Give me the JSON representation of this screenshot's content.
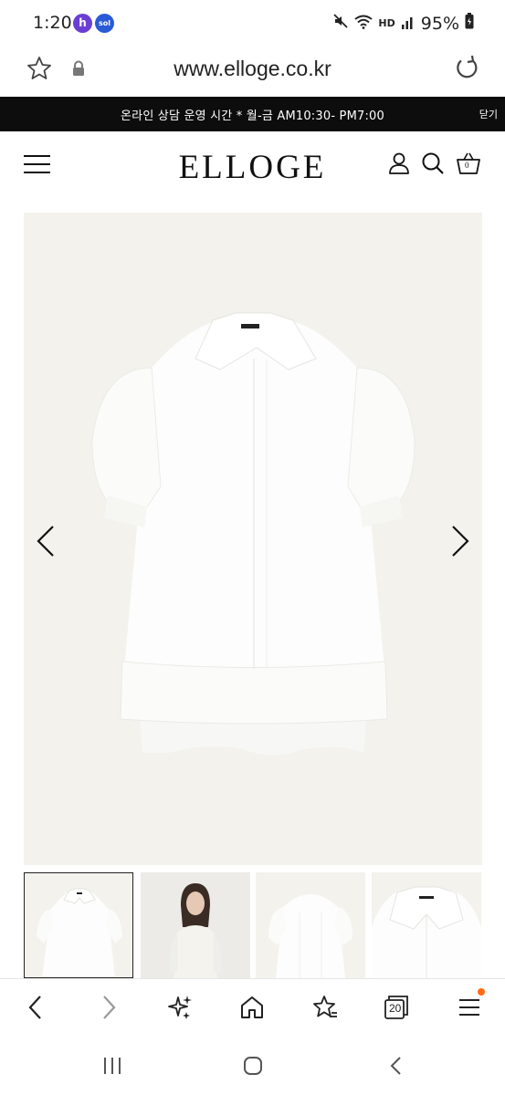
{
  "status_bar": {
    "time": "1:20",
    "app_icon_1": "h",
    "app_icon_2": "sol",
    "network": "HD",
    "battery": "95%"
  },
  "browser": {
    "url": "www.elloge.co.kr"
  },
  "notice": {
    "text": "온라인 상담 운영 시간 * 월-금 AM10:30- PM7:00",
    "close_label": "닫기"
  },
  "header": {
    "logo": "ELLOGE",
    "cart_count": "0"
  },
  "toolbar": {
    "tab_count": "20"
  },
  "icons": {
    "url_star": "star-outline-icon",
    "url_lock": "lock-icon",
    "reload": "reload-icon",
    "menu": "hamburger-icon",
    "account": "user-icon",
    "search": "search-icon",
    "cart": "basket-icon"
  },
  "colors": {
    "notice_bg": "#0d0d0d",
    "image_bg": "#f3f2ed",
    "notif_dot": "#ff6a13"
  }
}
